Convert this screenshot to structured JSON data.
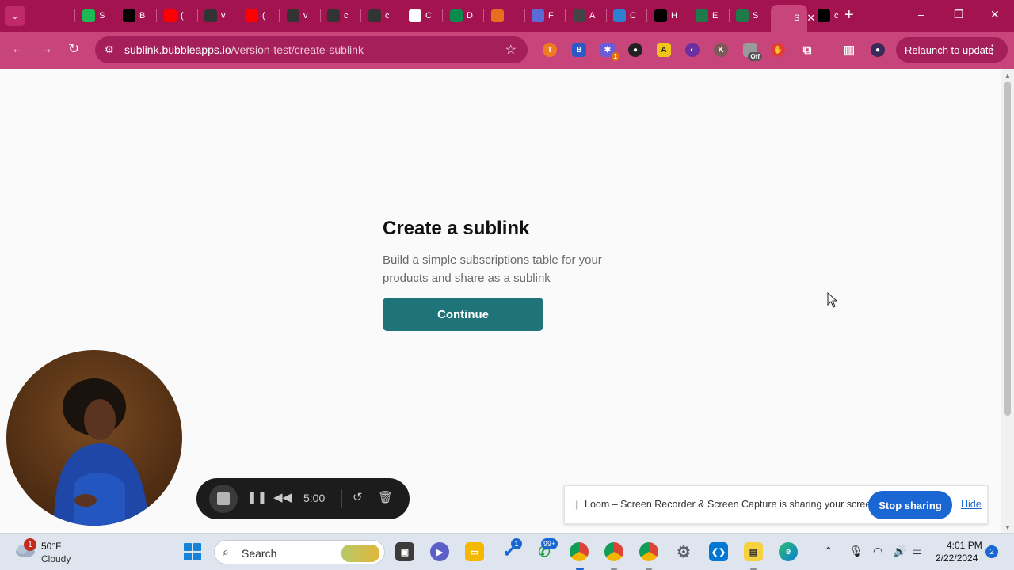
{
  "browser": {
    "tabs": [
      {
        "label": "",
        "color": "#a3134f"
      },
      {
        "label": "S",
        "color": "#1db954"
      },
      {
        "label": "B",
        "color": "#000000"
      },
      {
        "label": "(",
        "color": "#ff0000"
      },
      {
        "label": "v",
        "color": "#333333"
      },
      {
        "label": "(",
        "color": "#ff0000"
      },
      {
        "label": "v",
        "color": "#333333"
      },
      {
        "label": "c",
        "color": "#333333"
      },
      {
        "label": "c",
        "color": "#333333"
      },
      {
        "label": "C",
        "color": "#ffffff"
      },
      {
        "label": "D",
        "color": "#0a8a4b"
      },
      {
        "label": ",",
        "color": "#e36f1f"
      },
      {
        "label": "F",
        "color": "#5a6bd6"
      },
      {
        "label": "A",
        "color": "#444444"
      },
      {
        "label": "C",
        "color": "#2f7fd1"
      },
      {
        "label": "H",
        "color": "#000000"
      },
      {
        "label": "E",
        "color": "#1f7a4a"
      },
      {
        "label": "S",
        "color": "#1f7a4a"
      },
      {
        "label": "S",
        "color": "#c8457c"
      },
      {
        "label": "c",
        "color": "#000000"
      }
    ],
    "active_close": "✕",
    "new_tab": "+",
    "window_controls": {
      "minimize": "–",
      "restore": "❐",
      "close": "✕"
    },
    "url_host": "sublink.bubbleapps.io",
    "url_path": "/version-test/create-sublink",
    "relaunch_label": "Relaunch to update",
    "extension_badge": "1",
    "off_badge": "Off"
  },
  "page": {
    "title": "Create a sublink",
    "subtitle": "Build a simple subscriptions table for your products and share as a sublink",
    "continue_label": "Continue"
  },
  "loom": {
    "timer": "5:00",
    "share_text": "Loom – Screen Recorder & Screen Capture is sharing your screen.",
    "stop_sharing": "Stop sharing",
    "hide": "Hide"
  },
  "taskbar": {
    "weather_temp": "50°F",
    "weather_cond": "Cloudy",
    "weather_badge": "1",
    "search_label": "Search",
    "todo_badge": "1",
    "whatsapp_badge": "99+",
    "time": "4:01 PM",
    "date": "2/22/2024",
    "notifications": "2"
  },
  "colors": {
    "tabstrip": "#a3134f",
    "toolbar": "#c8457c",
    "continue_button": "#1f7479",
    "stop_sharing": "#1a66d2"
  }
}
